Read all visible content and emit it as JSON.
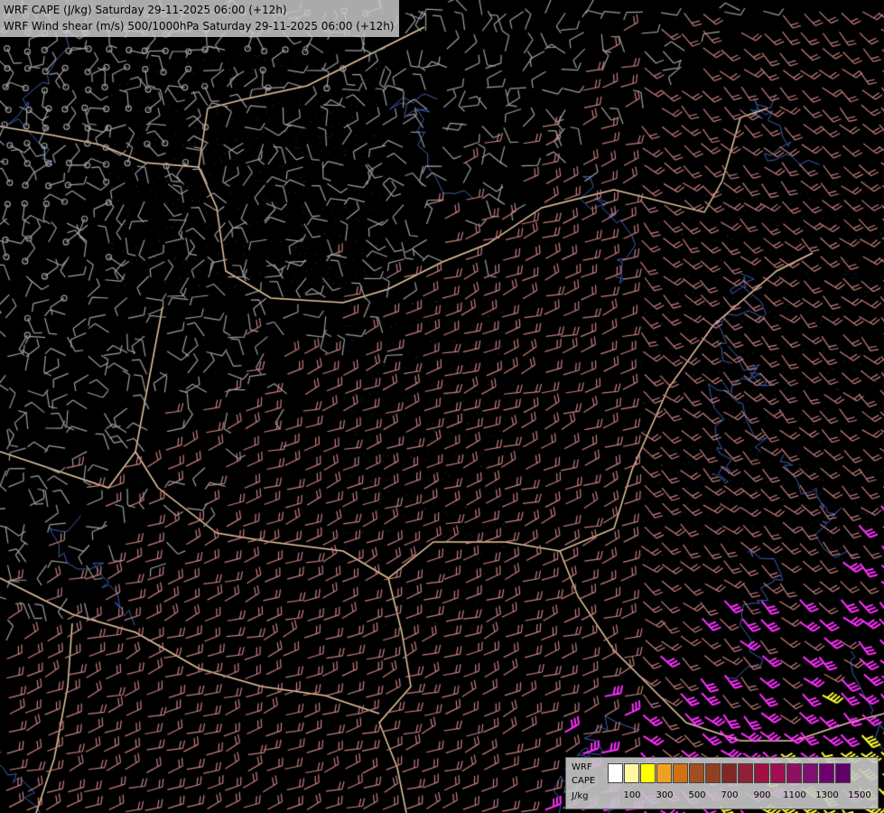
{
  "titles": {
    "line1": "WRF CAPE (J/kg) Saturday 29-11-2025 06:00 (+12h)",
    "line2": "WRF Wind shear (m/s) 500/1000hPa Saturday 29-11-2025 06:00 (+12h)"
  },
  "legend": {
    "label_top": "WRF",
    "label_mid": "CAPE",
    "label_unit": "J/kg",
    "colors": [
      "#ffffff",
      "#fff7a0",
      "#ffff00",
      "#f0a020",
      "#d07010",
      "#a05020",
      "#904020",
      "#802828",
      "#902038",
      "#a01040",
      "#a01050",
      "#901060",
      "#801070",
      "#700070",
      "#600068"
    ],
    "ticks": [
      "100",
      "300",
      "500",
      "700",
      "900",
      "1100",
      "1300",
      "1500"
    ]
  },
  "colors": {
    "background": "#000000",
    "border": "#e8c8a0",
    "river": "#4060b0",
    "barb_weak": "#a0a0a0",
    "barb_mid": "#c88080",
    "barb_strong": "#ff30ff",
    "barb_extreme": "#ffff30"
  }
}
